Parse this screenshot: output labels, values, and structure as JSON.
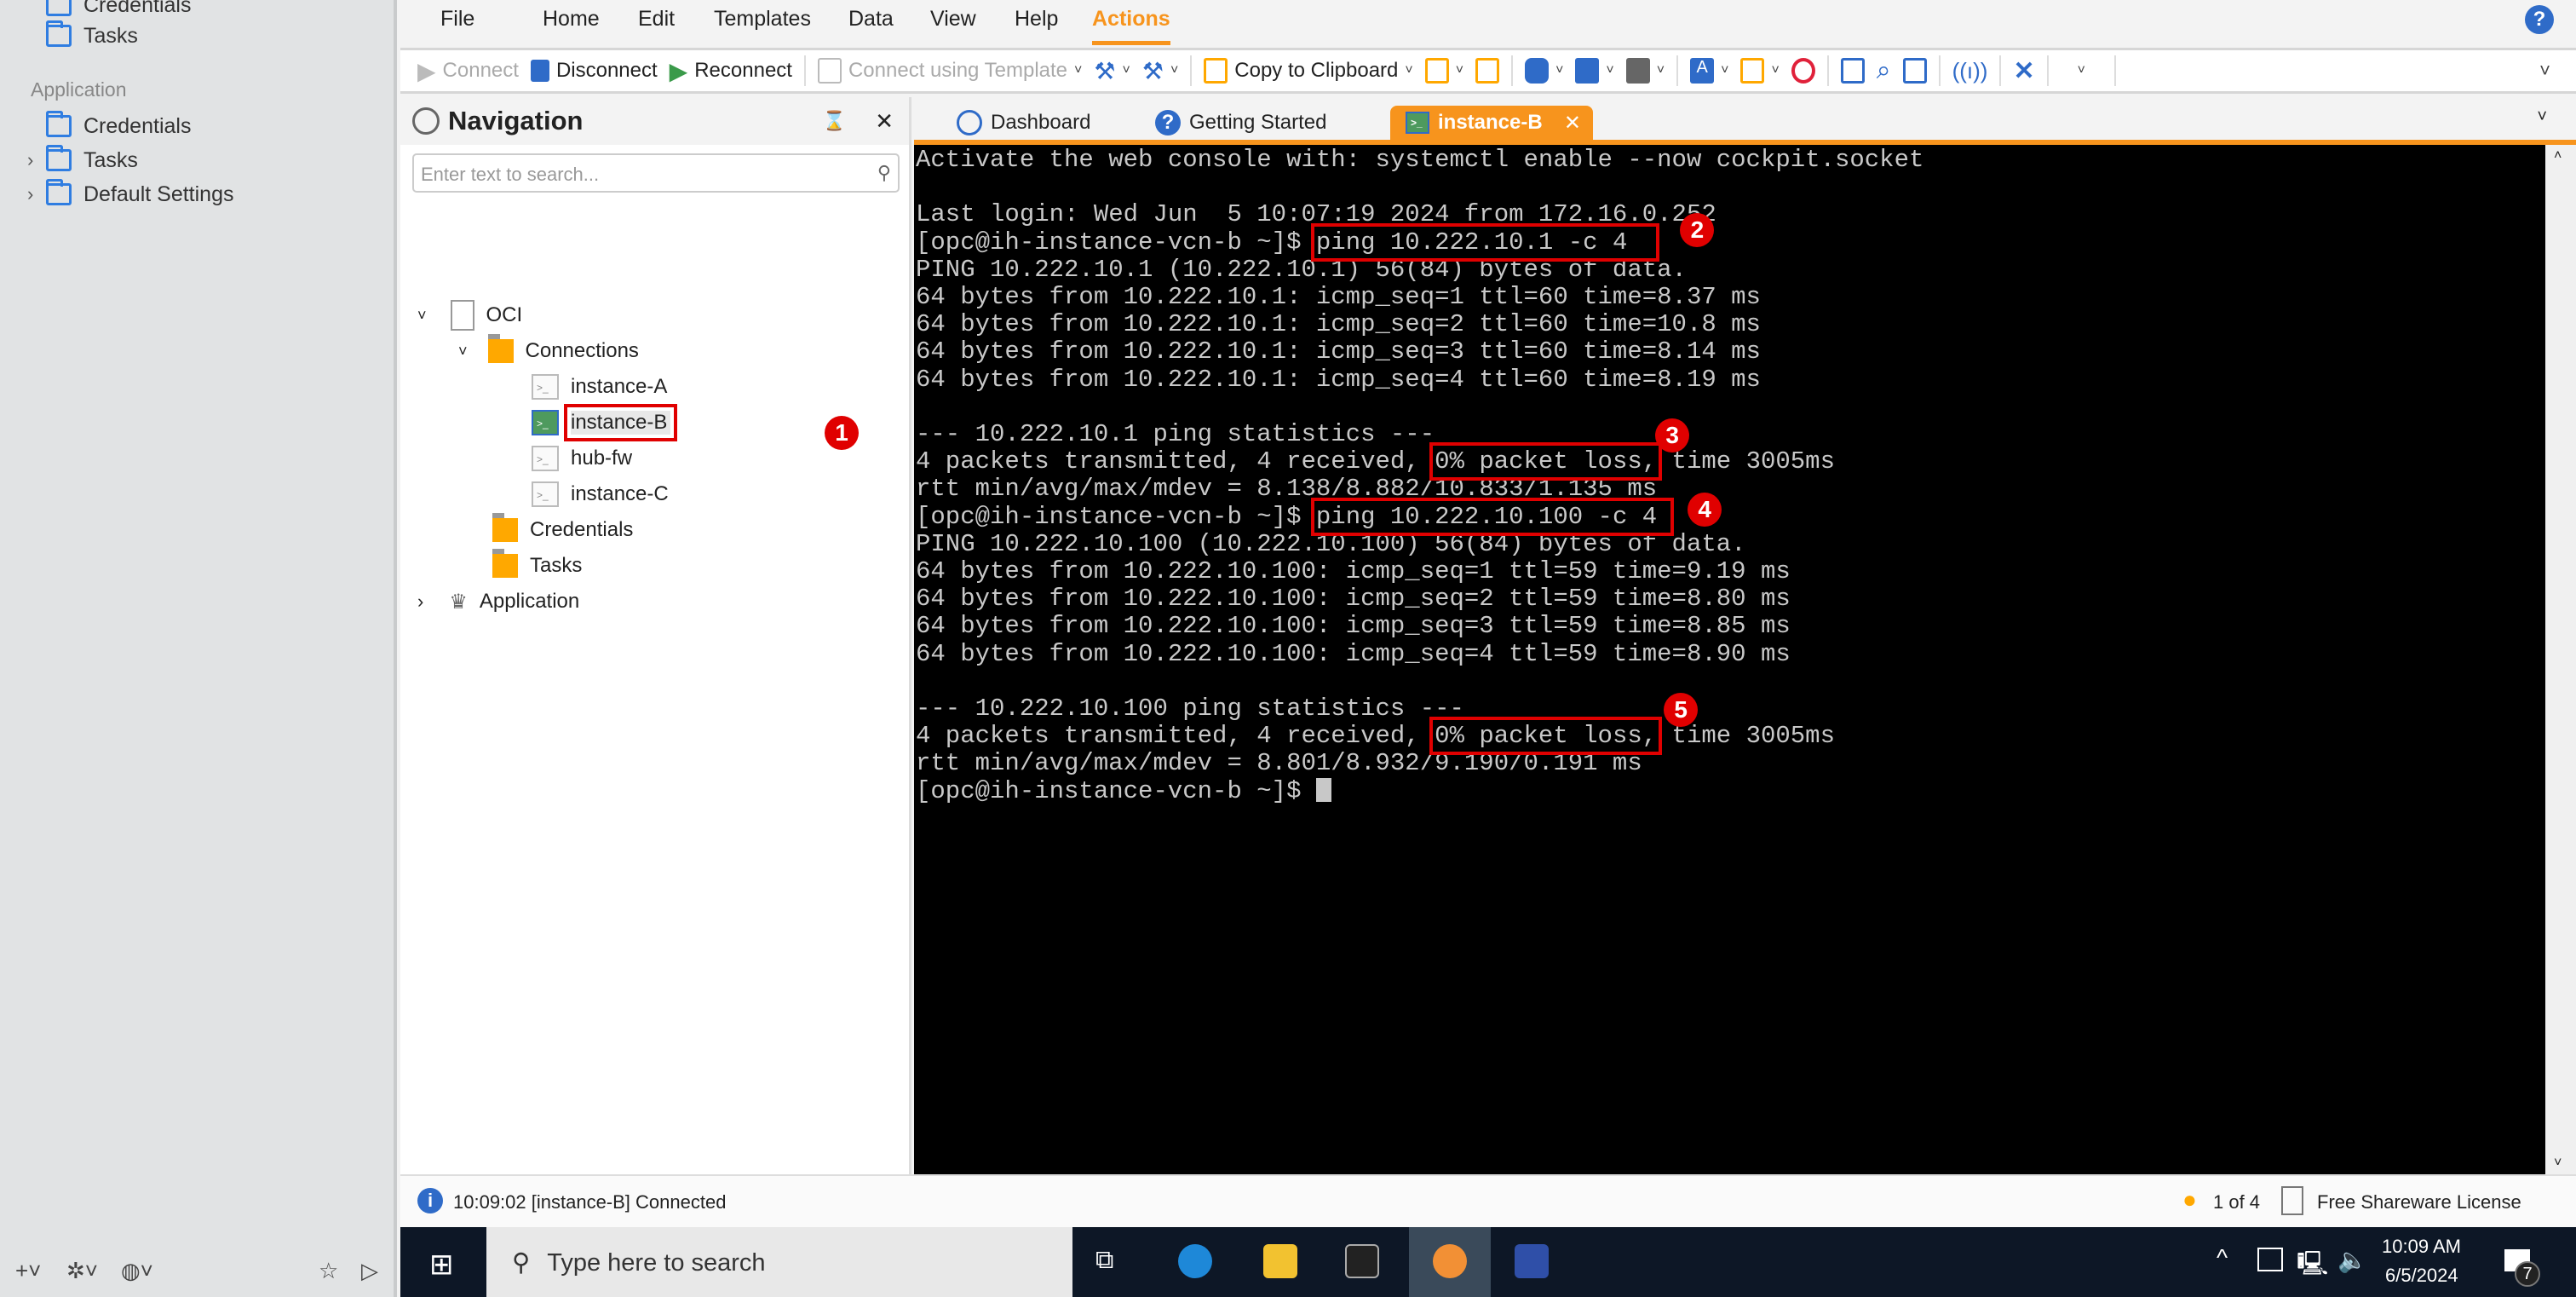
{
  "left_sidebar": {
    "items": [
      {
        "label": "Credentials"
      },
      {
        "label": "Tasks"
      }
    ],
    "section": "Application",
    "app_items": [
      {
        "label": "Credentials"
      },
      {
        "label": "Tasks"
      },
      {
        "label": "Default Settings"
      }
    ]
  },
  "menu": [
    "File",
    "Home",
    "Edit",
    "Templates",
    "Data",
    "View",
    "Help",
    "Actions"
  ],
  "toolbar": {
    "connect": "Connect",
    "disconnect": "Disconnect",
    "reconnect": "Reconnect",
    "connect_template": "Connect using Template",
    "copy_clipboard": "Copy to Clipboard"
  },
  "navigation": {
    "title": "Navigation",
    "search_placeholder": "Enter text to search...",
    "tree": {
      "root": "OCI",
      "connections": "Connections",
      "items": [
        "instance-A",
        "instance-B",
        "hub-fw",
        "instance-C"
      ],
      "credentials": "Credentials",
      "tasks": "Tasks",
      "application": "Application"
    }
  },
  "tabs": [
    "Dashboard",
    "Getting Started",
    "instance-B"
  ],
  "terminal": {
    "l0": "Activate the web console with: systemctl enable --now cockpit.socket",
    "l2": "Last login: Wed Jun  5 10:07:19 2024 from 172.16.0.252",
    "prompt": "[opc@ih-instance-vcn-b ~]$ ",
    "cmd1": "ping 10.222.10.1 -c 4",
    "l4": "PING 10.222.10.1 (10.222.10.1) 56(84) bytes of data.",
    "l5": "64 bytes from 10.222.10.1: icmp_seq=1 ttl=60 time=8.37 ms",
    "l6": "64 bytes from 10.222.10.1: icmp_seq=2 ttl=60 time=10.8 ms",
    "l7": "64 bytes from 10.222.10.1: icmp_seq=3 ttl=60 time=8.14 ms",
    "l8": "64 bytes from 10.222.10.1: icmp_seq=4 ttl=60 time=8.19 ms",
    "l10": "--- 10.222.10.1 ping statistics ---",
    "tx": "4 packets transmitted, 4 received, ",
    "loss": "0% packet loss,",
    "time": " time 3005ms",
    "l12": "rtt min/avg/max/mdev = 8.138/8.882/10.833/1.135 ms",
    "cmd2": "ping 10.222.10.100 -c 4",
    "l14": "PING 10.222.10.100 (10.222.10.100) 56(84) bytes of data.",
    "l15": "64 bytes from 10.222.10.100: icmp_seq=1 ttl=59 time=9.19 ms",
    "l16": "64 bytes from 10.222.10.100: icmp_seq=2 ttl=59 time=8.80 ms",
    "l17": "64 bytes from 10.222.10.100: icmp_seq=3 ttl=59 time=8.85 ms",
    "l18": "64 bytes from 10.222.10.100: icmp_seq=4 ttl=59 time=8.90 ms",
    "l20": "--- 10.222.10.100 ping statistics ---",
    "l22": "rtt min/avg/max/mdev = 8.801/8.932/9.190/0.191 ms"
  },
  "annotations": [
    "1",
    "2",
    "3",
    "4",
    "5"
  ],
  "status": {
    "message": "10:09:02 [instance-B] Connected",
    "tips": "1 of 4",
    "license": "Free Shareware License"
  },
  "taskbar": {
    "search_placeholder": "Type here to search",
    "time": "10:09 AM",
    "date": "6/5/2024",
    "notifications": "7"
  },
  "colors": {
    "accent": "#f7941d",
    "annotation": "#e00000",
    "terminal_bg": "#000000"
  }
}
